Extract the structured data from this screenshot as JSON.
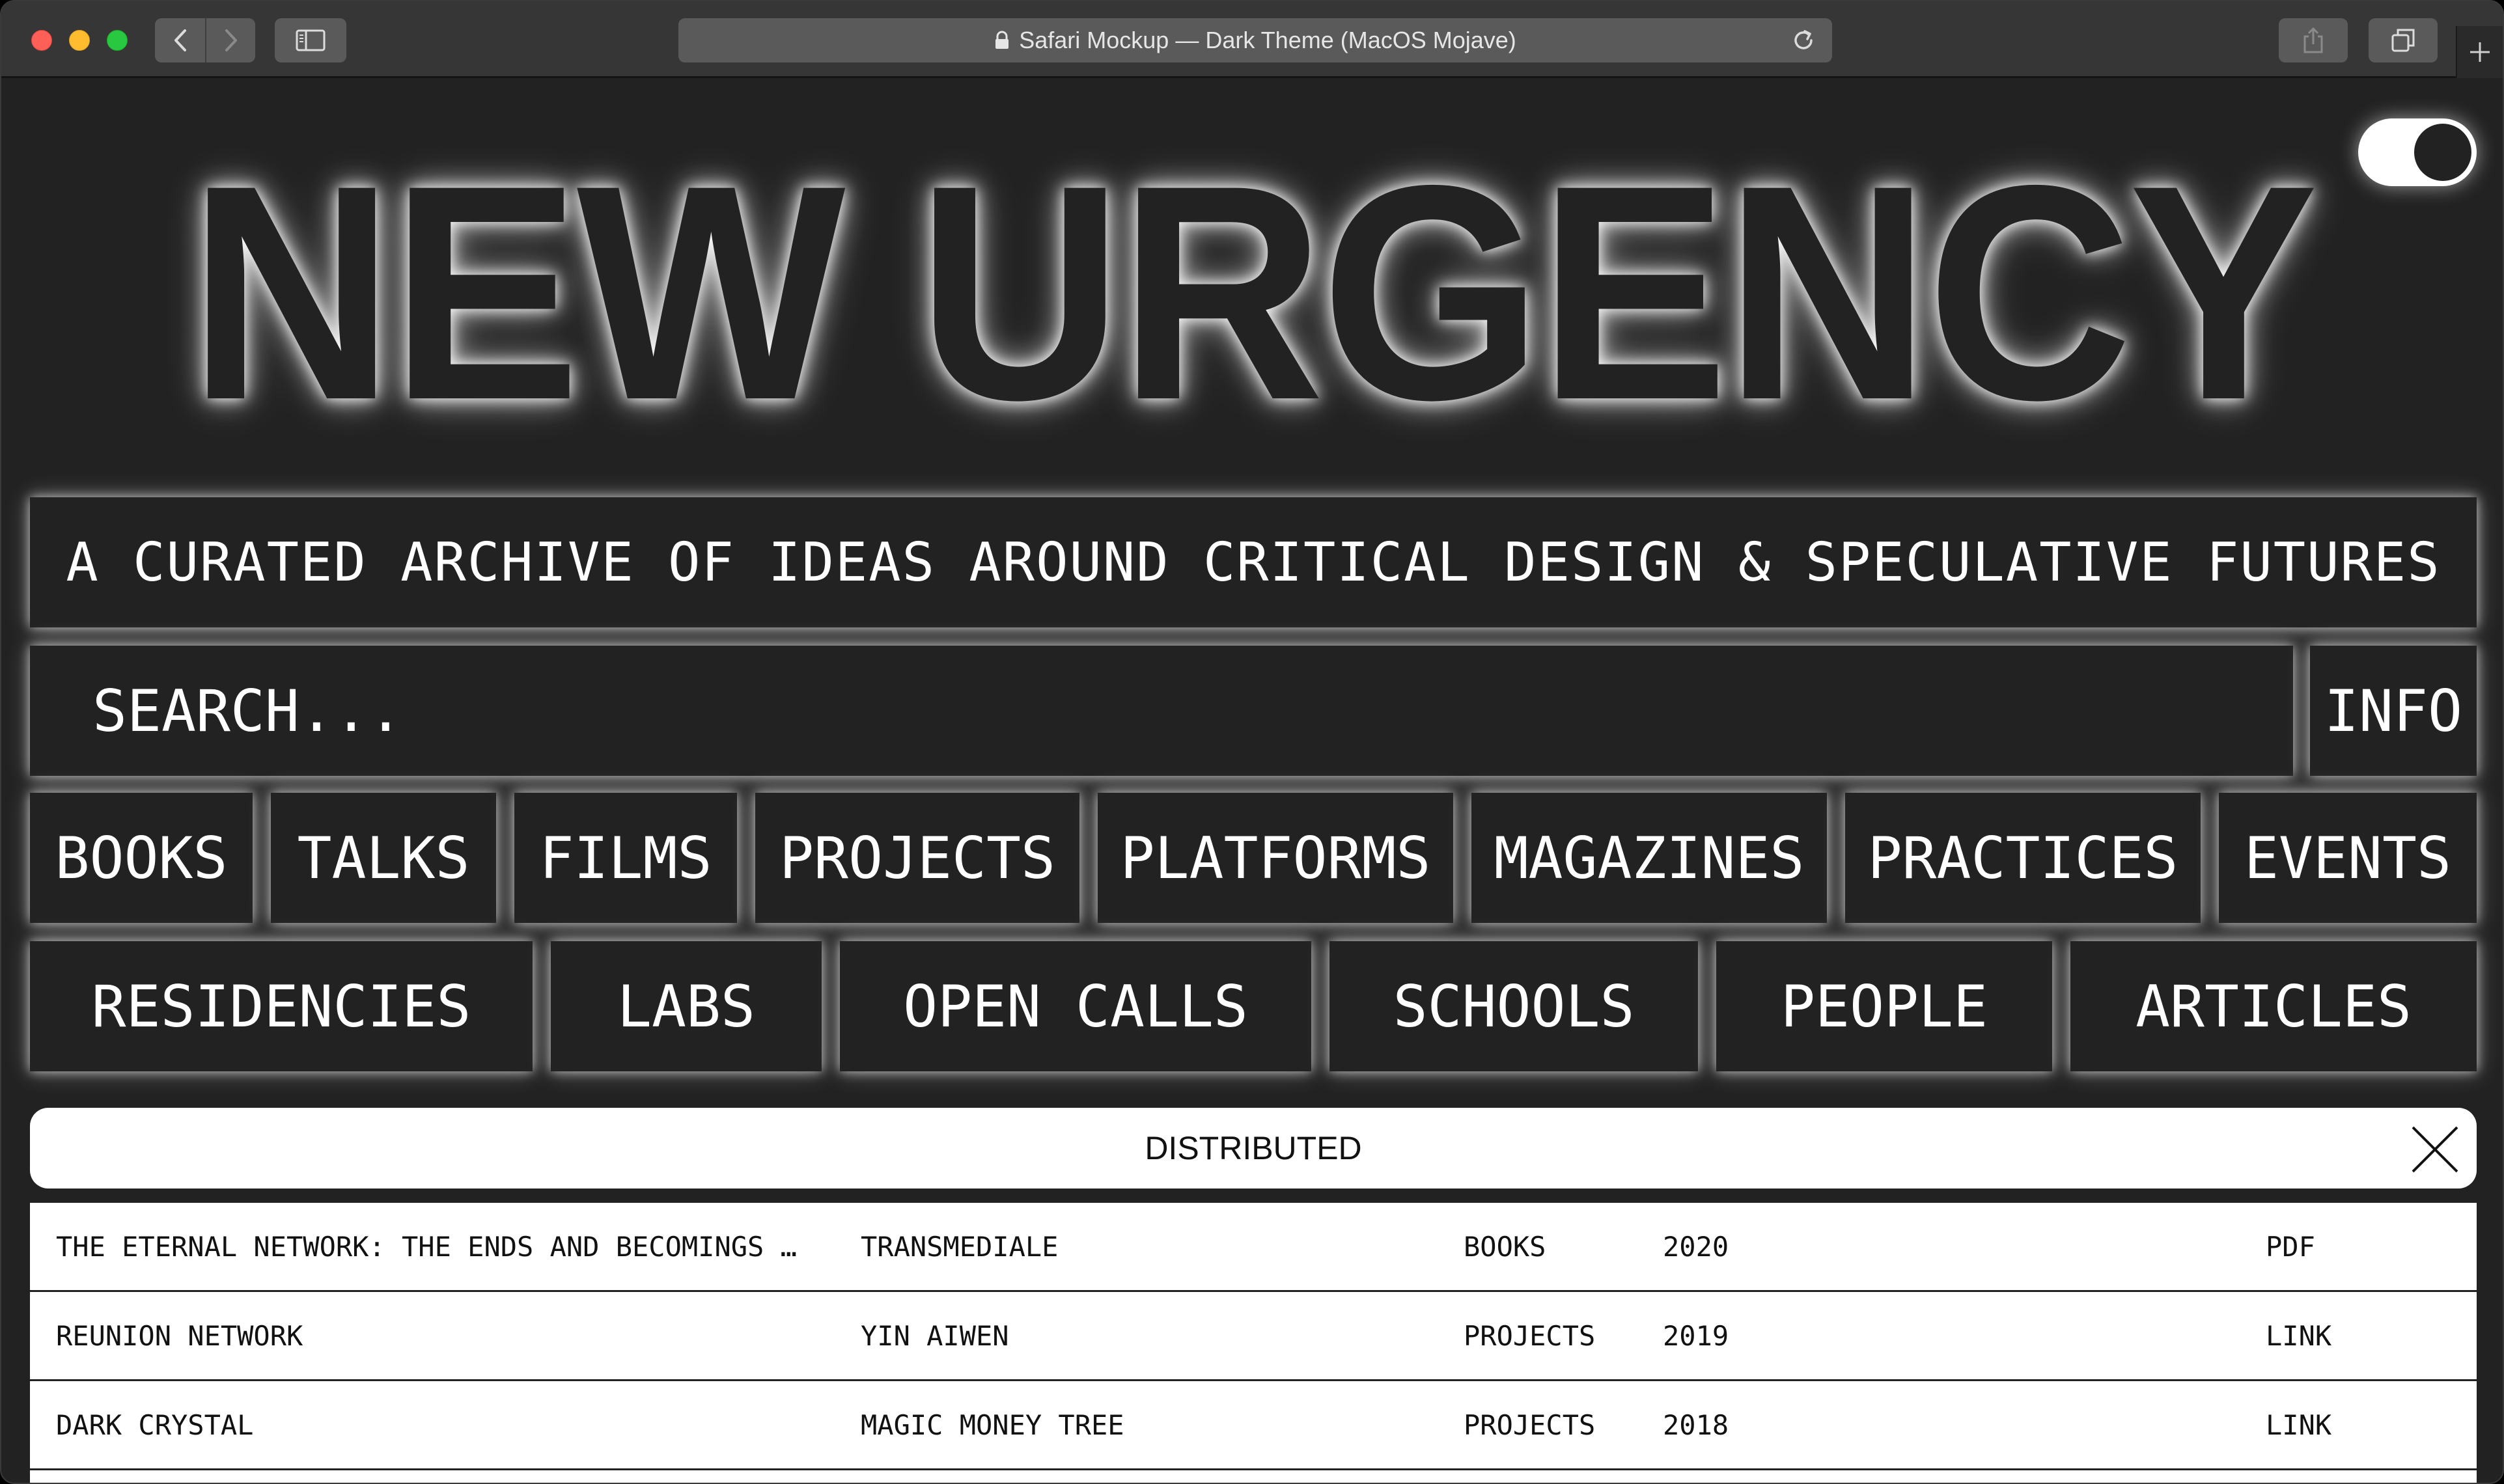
{
  "browser": {
    "address_text": "Safari Mockup — Dark Theme (MacOS Mojave)"
  },
  "site": {
    "logo": "NEW URGENCY",
    "tagline": "A CURATED ARCHIVE OF IDEAS AROUND CRITICAL DESIGN & SPECULATIVE FUTURES",
    "search": {
      "placeholder": "SEARCH..."
    },
    "info_label": "INFO",
    "categories_row1": [
      "BOOKS",
      "TALKS",
      "FILMS",
      "PROJECTS",
      "PLATFORMS",
      "MAGAZINES",
      "PRACTICES",
      "EVENTS"
    ],
    "categories_row2": [
      "RESIDENCIES",
      "LABS",
      "OPEN CALLS",
      "SCHOOLS",
      "PEOPLE",
      "ARTICLES"
    ],
    "active_filter": "DISTRIBUTED",
    "results": [
      {
        "title": "THE ETERNAL NETWORK: THE ENDS AND BECOMINGS …",
        "author": "TRANSMEDIALE",
        "category": "BOOKS",
        "year": "2020",
        "link": "PDF"
      },
      {
        "title": "REUNION NETWORK",
        "author": "YIN AIWEN",
        "category": "PROJECTS",
        "year": "2019",
        "link": "LINK"
      },
      {
        "title": "DARK CRYSTAL",
        "author": "MAGIC MONEY TREE",
        "category": "PROJECTS",
        "year": "2018",
        "link": "LINK"
      }
    ]
  },
  "colors": {
    "page_background": "#222222",
    "glow": "#ffffff",
    "toggle_on": "#ffffff"
  }
}
